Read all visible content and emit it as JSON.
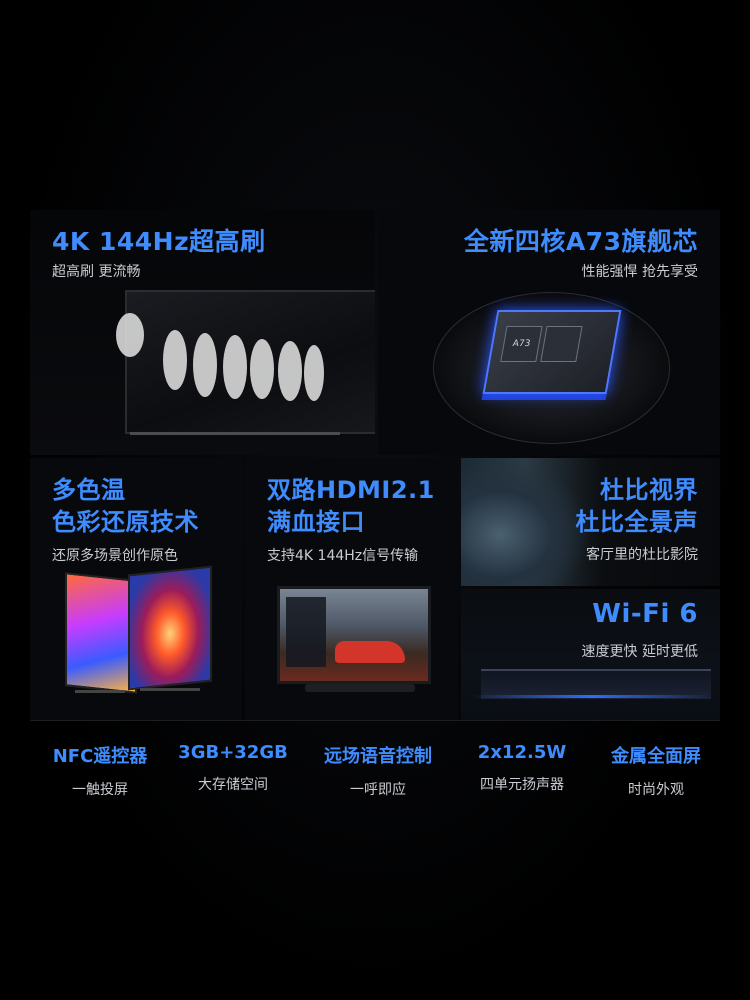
{
  "cards": {
    "refresh": {
      "title": "4K 144Hz超高刷",
      "sub": "超高刷 更流畅"
    },
    "chip": {
      "title": "全新四核A73旗舰芯",
      "sub": "性能强悍 抢先享受",
      "chip_label": "A73"
    },
    "color": {
      "title_line1": "多色温",
      "title_line2": "色彩还原技术",
      "sub": "还原多场景创作原色"
    },
    "hdmi": {
      "title_line1": "双路HDMI2.1",
      "title_line2": "满血接口",
      "sub": "支持4K 144Hz信号传输"
    },
    "dolby": {
      "title_line1": "杜比视界",
      "title_line2": "杜比全景声",
      "sub": "客厅里的杜比影院"
    },
    "wifi": {
      "title": "Wi-Fi 6",
      "sub": "速度更快 延时更低"
    }
  },
  "features": [
    {
      "title": "NFC遥控器",
      "sub": "一触投屏"
    },
    {
      "title": "3GB+32GB",
      "sub": "大存储空间"
    },
    {
      "title": "远场语音控制",
      "sub": "一呼即应"
    },
    {
      "title": "2x12.5W",
      "sub": "四单元扬声器"
    },
    {
      "title": "金属全面屏",
      "sub": "时尚外观"
    }
  ],
  "colors": {
    "accent": "#3f8cff",
    "background": "#000000",
    "subtext": "#c9ccd2"
  }
}
